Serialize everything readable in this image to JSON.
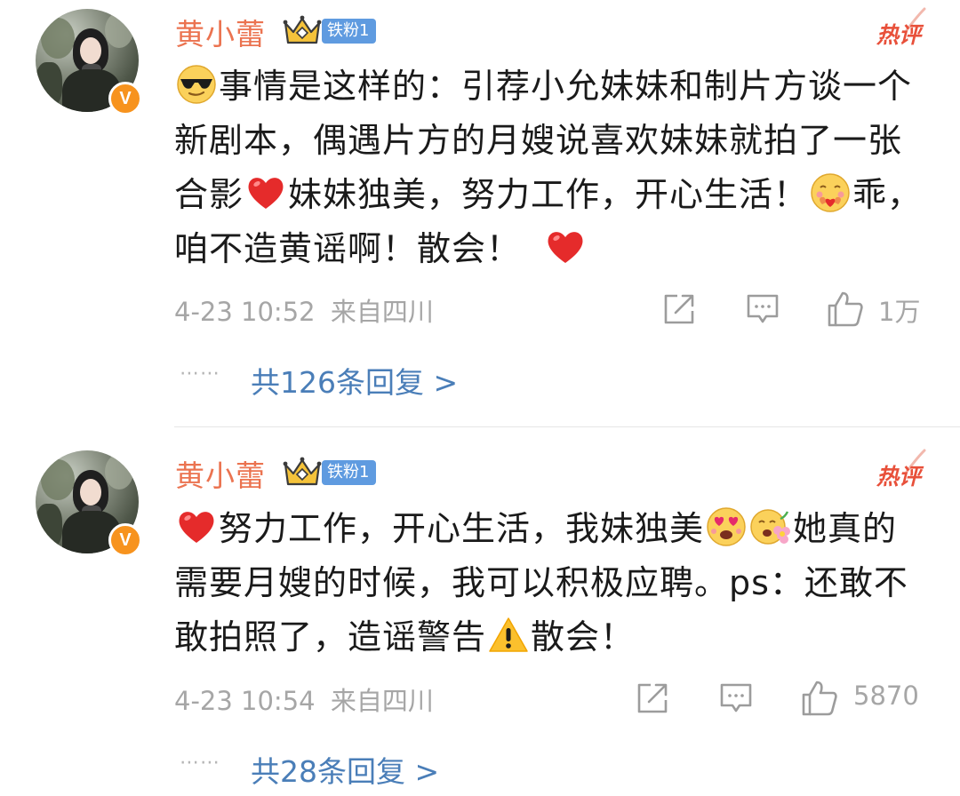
{
  "comments": [
    {
      "username": "黄小蕾",
      "fan_badge": "铁粉1",
      "verified_mark": "V",
      "hot_tag": "热评",
      "text": {
        "seg1": "事情是这样的：引荐小允妹妹和制片方谈一个新剧本，偶遇片方的月嫂说喜欢妹妹就拍了一张合影",
        "seg2": "妹妹独美，努力工作，开心生活！",
        "seg3": "乖，咱不造黄谣啊！散会！"
      },
      "timestamp": "4-23 10:52",
      "location": "来自四川",
      "likes": "1万",
      "replies": "共126条回复 >",
      "reply_dots": "⋯⋯"
    },
    {
      "username": "黄小蕾",
      "fan_badge": "铁粉1",
      "verified_mark": "V",
      "hot_tag": "热评",
      "text": {
        "seg1": "努力工作，开心生活，我妹独美",
        "seg2": "她真的需要月嫂的时候，我可以积极应聘。ps：还敢不敢拍照了，造谣警告",
        "seg3": "散会！"
      },
      "timestamp": "4-23 10:54",
      "location": "来自四川",
      "likes": "5870",
      "replies": "共28条回复 >",
      "reply_dots": "⋯⋯"
    }
  ],
  "icons": {
    "share": "share-icon",
    "comment": "comment-icon",
    "like": "thumbs-up-icon",
    "crown": "crown-icon",
    "emoji_cool": "sunglasses-emoji-icon",
    "emoji_heart": "red-heart-icon",
    "emoji_hug": "hugging-emoji-icon",
    "emoji_heart_eyes": "heart-eyes-emoji-icon",
    "emoji_flower": "flower-face-emoji-icon",
    "emoji_warning": "warning-icon"
  },
  "colors": {
    "username": "#eb7350",
    "fan_badge": "#5f9be0",
    "hot_tag": "#e8503a",
    "reply_link": "#4a7eb8",
    "meta": "#a6a6a6",
    "verified": "#f7931e"
  }
}
